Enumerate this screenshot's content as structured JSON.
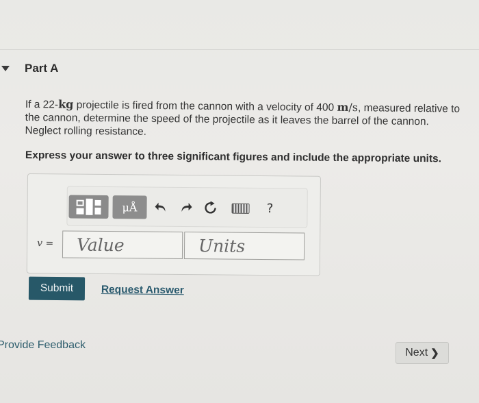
{
  "part": {
    "title": "Part A"
  },
  "question": {
    "text_1": "If a 22-",
    "mass_unit": "kg",
    "text_2": " projectile is fired from the cannon with a velocity of 400 ",
    "vel_unit_num": "m",
    "vel_unit_sep": "/",
    "vel_unit_den": "s",
    "text_3": ", measured relative to the cannon, determine the speed of the projectile as it leaves the barrel of the cannon. Neglect rolling resistance."
  },
  "instruction": "Express your answer to three significant figures and include the appropriate units.",
  "toolbar": {
    "mu_label": "μÅ",
    "help_label": "?",
    "icons": [
      "templates-icon",
      "units-icon",
      "undo-icon",
      "redo-icon",
      "reset-icon",
      "keyboard-icon",
      "help-icon"
    ]
  },
  "answer": {
    "variable": "v",
    "equals": " =",
    "value_placeholder": "Value",
    "units_placeholder": "Units"
  },
  "actions": {
    "submit_label": "Submit",
    "request_label": "Request Answer",
    "feedback_label": "Provide Feedback",
    "next_label": "Next",
    "next_chevron": "❯"
  },
  "colors": {
    "submit_bg": "#275868",
    "link": "#2a5a6e",
    "background": "#ebebe8"
  }
}
